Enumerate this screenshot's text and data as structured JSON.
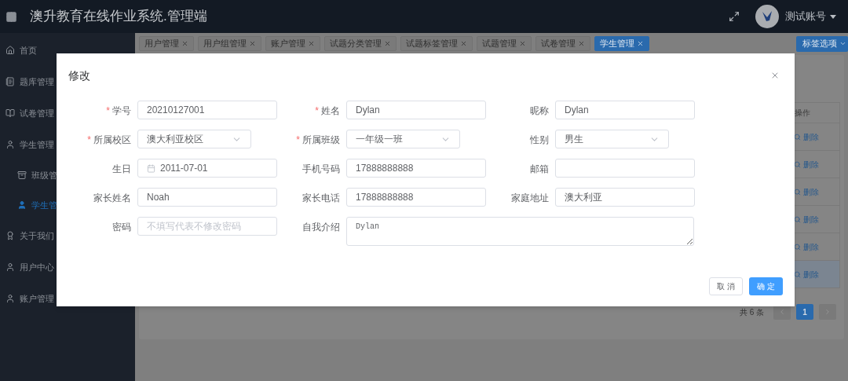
{
  "header": {
    "title": "澳升教育在线作业系统.管理端",
    "user": "测试账号"
  },
  "sidebar": {
    "items": [
      {
        "label": "首页",
        "selected": false
      },
      {
        "label": "题库管理",
        "selected": false
      },
      {
        "label": "试卷管理",
        "selected": false
      },
      {
        "label": "学生管理",
        "selected": false,
        "children": [
          {
            "label": "班级管",
            "selected": false
          },
          {
            "label": "学生管",
            "selected": true
          }
        ]
      },
      {
        "label": "关于我们",
        "selected": false
      },
      {
        "label": "用户中心",
        "selected": false
      },
      {
        "label": "账户管理",
        "selected": false
      }
    ]
  },
  "tabs": [
    {
      "label": "用户管理",
      "selected": false
    },
    {
      "label": "用户组管理",
      "selected": false
    },
    {
      "label": "账户管理",
      "selected": false
    },
    {
      "label": "试题分类管理",
      "selected": false
    },
    {
      "label": "试题标签管理",
      "selected": false
    },
    {
      "label": "试题管理",
      "selected": false
    },
    {
      "label": "试卷管理",
      "selected": false
    },
    {
      "label": "学生管理",
      "selected": true
    }
  ],
  "tab_options": "标签选项",
  "table": {
    "column": "操作",
    "rows": [
      {
        "action": "删除",
        "highlighted": false
      },
      {
        "action": "删除",
        "highlighted": false
      },
      {
        "action": "删除",
        "highlighted": false
      },
      {
        "action": "删除",
        "highlighted": false
      },
      {
        "action": "删除",
        "highlighted": false
      },
      {
        "action": "删除",
        "highlighted": true
      }
    ]
  },
  "pagination": {
    "total": "共 6 条",
    "pages": [
      {
        "label": "1",
        "selected": true
      }
    ]
  },
  "dialog": {
    "title": "修改",
    "fields": [
      {
        "label": "学号",
        "mark": "*",
        "kind": "input",
        "value": "20210127001"
      },
      {
        "label": "姓名",
        "mark": "*",
        "kind": "input",
        "value": "Dylan"
      },
      {
        "label": "昵称",
        "kind": "input",
        "value": "Dylan"
      },
      {
        "label": "所属校区",
        "mark": "*",
        "kind": "select",
        "value": "澳大利亚校区"
      },
      {
        "label": "所属班级",
        "mark": "*",
        "kind": "select",
        "value": "一年级一班"
      },
      {
        "label": "性别",
        "kind": "select",
        "value": "男生"
      },
      {
        "label": "生日",
        "kind": "date",
        "value": "2011-07-01"
      },
      {
        "label": "手机号码",
        "kind": "input",
        "value": "17888888888"
      },
      {
        "label": "邮箱",
        "kind": "input"
      },
      {
        "label": "家长姓名",
        "kind": "input",
        "value": "Noah"
      },
      {
        "label": "家长电话",
        "kind": "input",
        "value": "17888888888"
      },
      {
        "label": "家庭地址",
        "kind": "input",
        "value": "澳大利亚"
      },
      {
        "label": "密码",
        "kind": "input",
        "placeholder": "不填写代表不修改密码"
      },
      {
        "label": "自我介绍",
        "kind": "textarea",
        "value": "Dylan"
      }
    ],
    "buttons": [
      {
        "label": "取 消",
        "kind": "default"
      },
      {
        "label": "确 定",
        "kind": "primary"
      }
    ]
  }
}
